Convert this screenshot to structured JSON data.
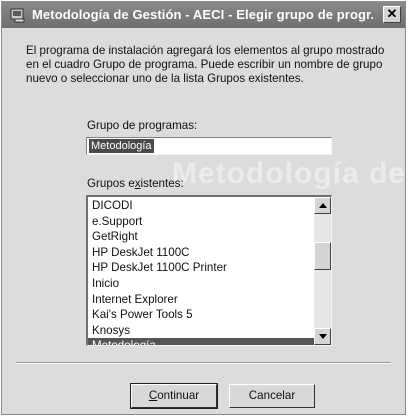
{
  "window": {
    "title": "Metodología de Gestión - AECI - Elegir grupo de progr..."
  },
  "intro_text": "El programa de instalación agregará los elementos al grupo mostrado en el cuadro Grupo de programa. Puede escribir un nombre de grupo nuevo o seleccionar uno de la lista Grupos existentes.",
  "watermark_text": "Metodología de Gest",
  "group_field": {
    "label_pre": "Grupo de pro",
    "label_key": "g",
    "label_post": "ramas:",
    "value": "Metodología"
  },
  "existing_groups": {
    "label_pre": "Grupos e",
    "label_key": "x",
    "label_post": "istentes:",
    "items": [
      "DICODI",
      "e.Support",
      "GetRight",
      "HP DeskJet 1100C",
      "HP DeskJet 1100C Printer",
      "Inicio",
      "Internet Explorer",
      "Kai's Power Tools 5",
      "Knosys",
      "Metodología"
    ],
    "selected_item": "Metodología"
  },
  "buttons": {
    "continue_key": "C",
    "continue_rest": "ontinuar",
    "cancel_label": "Cancelar"
  },
  "icons": {
    "title_icon": "setup-program-icon",
    "close": "close-icon",
    "scroll_up": "arrow-up-icon",
    "scroll_down": "arrow-down-icon"
  },
  "colors": {
    "title_bar": "#7a7a7a",
    "selection": "#555555",
    "dialog_bg": "#dcdcdc"
  }
}
